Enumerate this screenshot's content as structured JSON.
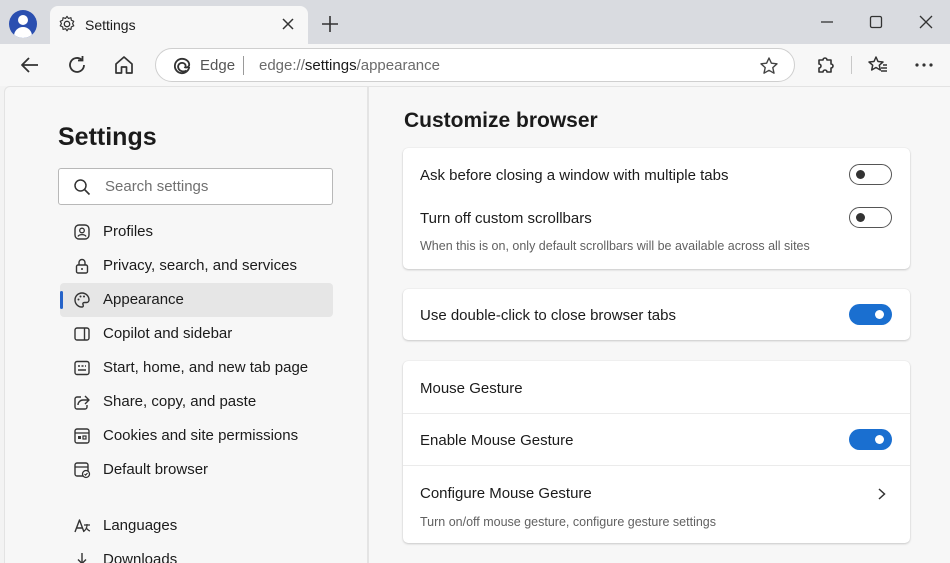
{
  "tab": {
    "title": "Settings"
  },
  "address": {
    "brand": "Edge",
    "url_prefix": "edge://",
    "url_host": "settings",
    "url_path": "/appearance"
  },
  "sidebar": {
    "title": "Settings",
    "search_placeholder": "Search settings",
    "items": [
      {
        "label": "Profiles",
        "icon": "profile-icon"
      },
      {
        "label": "Privacy, search, and services",
        "icon": "lock-icon"
      },
      {
        "label": "Appearance",
        "icon": "palette-icon",
        "active": true
      },
      {
        "label": "Copilot and sidebar",
        "icon": "sidebar-icon"
      },
      {
        "label": "Start, home, and new tab page",
        "icon": "home-page-icon"
      },
      {
        "label": "Share, copy, and paste",
        "icon": "share-icon"
      },
      {
        "label": "Cookies and site permissions",
        "icon": "cookies-icon"
      },
      {
        "label": "Default browser",
        "icon": "browser-icon"
      },
      {
        "label": "Languages",
        "icon": "languages-icon"
      },
      {
        "label": "Downloads",
        "icon": "download-icon"
      }
    ]
  },
  "main": {
    "title": "Customize browser",
    "card1": {
      "ask_close": {
        "label": "Ask before closing a window with multiple tabs",
        "enabled": false
      },
      "scrollbars": {
        "label": "Turn off custom scrollbars",
        "desc": "When this is on, only default scrollbars will be available across all sites",
        "enabled": false
      }
    },
    "card2": {
      "label": "Use double-click to close browser tabs",
      "enabled": true
    },
    "card3": {
      "header": "Mouse Gesture",
      "enable": {
        "label": "Enable Mouse Gesture",
        "enabled": true
      },
      "configure": {
        "label": "Configure Mouse Gesture",
        "desc": "Turn on/off mouse gesture, configure gesture settings"
      }
    }
  },
  "colors": {
    "accent": "#1a6fd0",
    "active_indicator": "#2563c8"
  }
}
